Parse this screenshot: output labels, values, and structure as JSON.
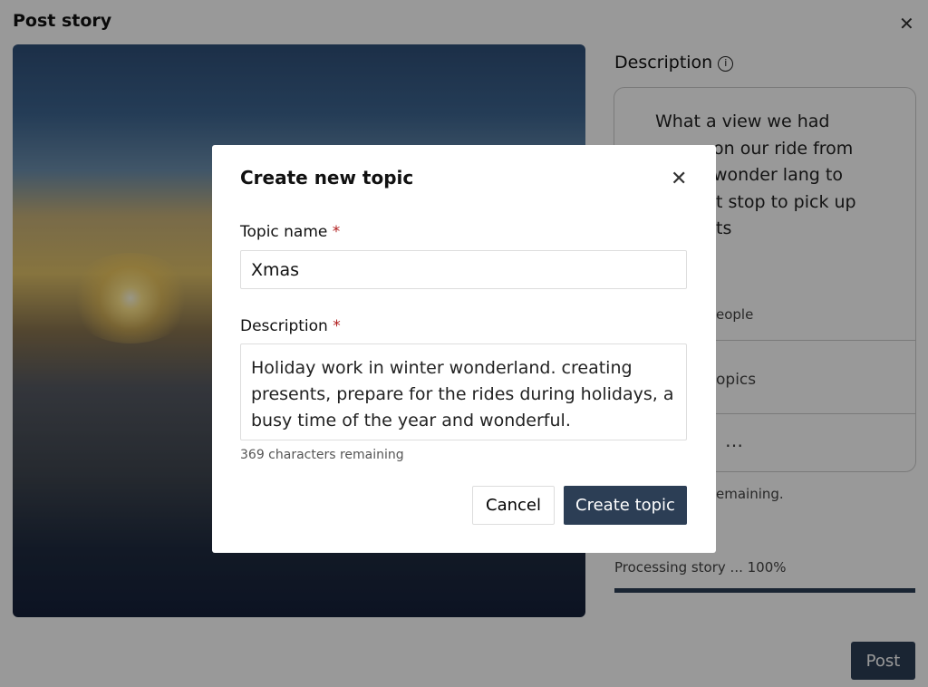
{
  "page": {
    "title": "Post story",
    "close_icon": "close-icon",
    "post_label": "Post"
  },
  "side": {
    "description_label": "Description",
    "info_icon": "i",
    "text_lines": [
      "What a view we had",
      "on our ride from",
      "wonder lang to",
      "t stop to pick up",
      "ts"
    ],
    "row_fragments": [
      "eople",
      "opics",
      "…"
    ],
    "remaining_fragment": "emaining.",
    "processing": "Processing story ... 100%",
    "progress_percent": 100
  },
  "modal": {
    "title": "Create new topic",
    "topic_label": "Topic name",
    "required": "*",
    "topic_value": "Xmas",
    "description_label": "Description",
    "description_value": "Holiday work in winter wonderland. creating presents, prepare for the rides during holidays, a busy time of the year and wonderful.",
    "remaining": "369 characters remaining",
    "cancel": "Cancel",
    "create": "Create topic"
  }
}
